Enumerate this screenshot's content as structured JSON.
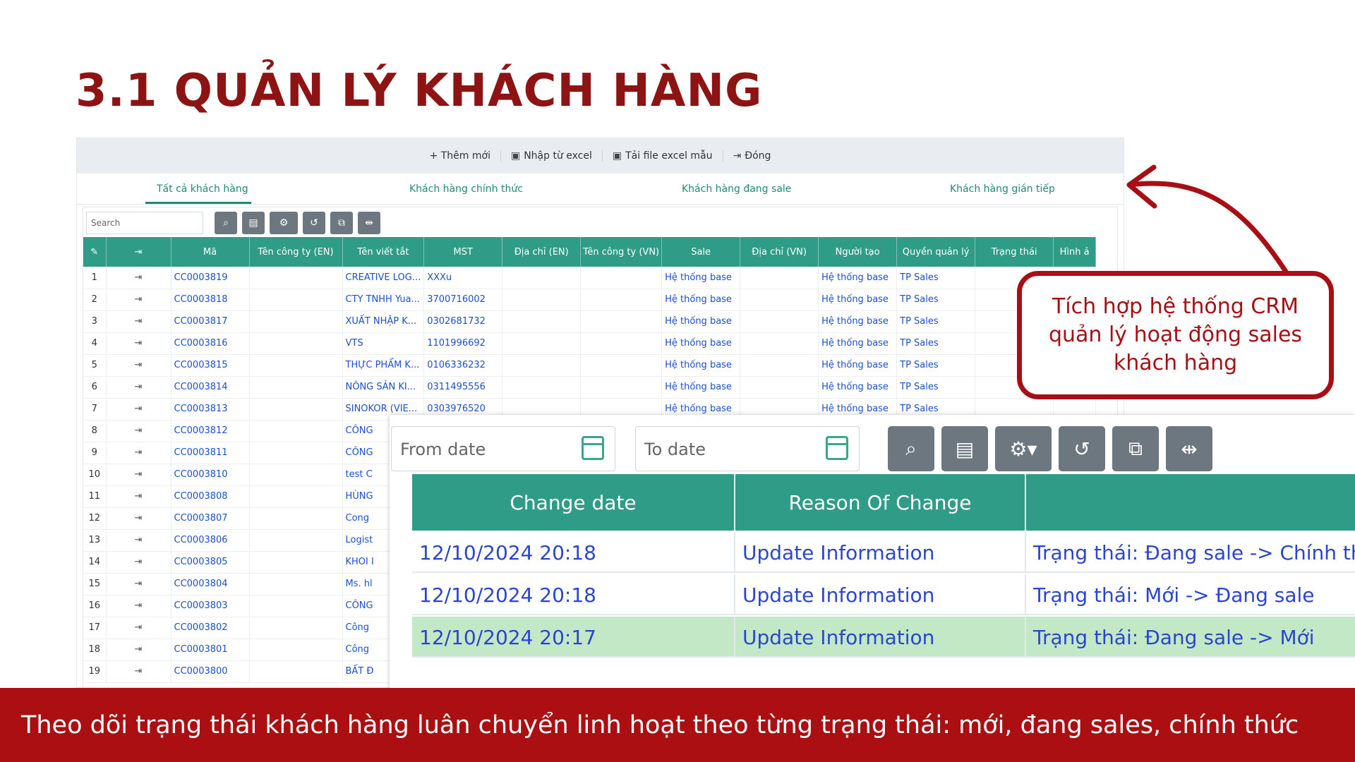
{
  "slide": {
    "title": "3.1 QUẢN LÝ KHÁCH HÀNG",
    "callout": "Tích hợp hệ thống CRM quản lý hoạt động sales khách hàng",
    "footer": "Theo dõi trạng thái khách hàng luân chuyển linh hoạt theo từng trạng thái: mới, đang sales, chính thức"
  },
  "toolbar": {
    "add": "+ Thêm mới",
    "import": "Nhập từ excel",
    "template": "Tải file excel mẫu",
    "close": "Đóng"
  },
  "tabs": [
    "Tất cả khách hàng",
    "Khách hàng chính thức",
    "Khách hàng đang sale",
    "Khách hàng gián tiếp"
  ],
  "search": {
    "placeholder": "Search"
  },
  "grid": {
    "columns": [
      "",
      "",
      "Mã",
      "Tên công ty (EN)",
      "Tên viết tắt",
      "MST",
      "Địa chỉ (EN)",
      "Tên công ty (VN)",
      "Sale",
      "Địa chỉ (VN)",
      "Người tạo",
      "Quyền quản lý",
      "Trạng thái",
      "Hình ả"
    ],
    "rows": [
      {
        "n": "1",
        "code": "CC0003819",
        "short": "CREATIVE LOG...",
        "mst": "XXXu",
        "sale": "Hệ thống base",
        "creator": "Hệ thống base",
        "perm": "TP Sales"
      },
      {
        "n": "2",
        "code": "CC0003818",
        "short": "CTY TNHH Yua...",
        "mst": "3700716002",
        "sale": "Hệ thống base",
        "creator": "Hệ thống base",
        "perm": "TP Sales"
      },
      {
        "n": "3",
        "code": "CC0003817",
        "short": "XUẤT NHẬP K...",
        "mst": "0302681732",
        "sale": "Hệ thống base",
        "creator": "Hệ thống base",
        "perm": "TP Sales"
      },
      {
        "n": "4",
        "code": "CC0003816",
        "short": "VTS",
        "mst": "1101996692",
        "sale": "Hệ thống base",
        "creator": "Hệ thống base",
        "perm": "TP Sales"
      },
      {
        "n": "5",
        "code": "CC0003815",
        "short": "THỰC PHẨM K...",
        "mst": "0106336232",
        "sale": "Hệ thống base",
        "creator": "Hệ thống base",
        "perm": "TP Sales"
      },
      {
        "n": "6",
        "code": "CC0003814",
        "short": "NÔNG SẢN KI...",
        "mst": "0311495556",
        "sale": "Hệ thống base",
        "creator": "Hệ thống base",
        "perm": "TP Sales"
      },
      {
        "n": "7",
        "code": "CC0003813",
        "short": "SINOKOR (VIE...",
        "mst": "0303976520",
        "sale": "Hệ thống base",
        "creator": "Hệ thống base",
        "perm": "TP Sales"
      },
      {
        "n": "8",
        "code": "CC0003812",
        "short": "CÔNG",
        "mst": "",
        "sale": "",
        "creator": "",
        "perm": ""
      },
      {
        "n": "9",
        "code": "CC0003811",
        "short": "CÔNG",
        "mst": "",
        "sale": "",
        "creator": "",
        "perm": ""
      },
      {
        "n": "10",
        "code": "CC0003810",
        "short": "test C",
        "mst": "",
        "sale": "",
        "creator": "",
        "perm": ""
      },
      {
        "n": "11",
        "code": "CC0003808",
        "short": "HÙNG",
        "mst": "",
        "sale": "",
        "creator": "",
        "perm": ""
      },
      {
        "n": "12",
        "code": "CC0003807",
        "short": "Cong",
        "mst": "",
        "sale": "",
        "creator": "",
        "perm": ""
      },
      {
        "n": "13",
        "code": "CC0003806",
        "short": "Logist",
        "mst": "",
        "sale": "",
        "creator": "",
        "perm": ""
      },
      {
        "n": "14",
        "code": "CC0003805",
        "short": "KHOI I",
        "mst": "",
        "sale": "",
        "creator": "",
        "perm": ""
      },
      {
        "n": "15",
        "code": "CC0003804",
        "short": "Ms. hl",
        "mst": "",
        "sale": "",
        "creator": "",
        "perm": ""
      },
      {
        "n": "16",
        "code": "CC0003803",
        "short": "CÔNG",
        "mst": "",
        "sale": "",
        "creator": "",
        "perm": ""
      },
      {
        "n": "17",
        "code": "CC0003802",
        "short": "Công",
        "mst": "",
        "sale": "",
        "creator": "",
        "perm": ""
      },
      {
        "n": "18",
        "code": "CC0003801",
        "short": "Công",
        "mst": "",
        "sale": "",
        "creator": "",
        "perm": ""
      },
      {
        "n": "19",
        "code": "CC0003800",
        "short": "BẤT Đ",
        "mst": "",
        "sale": "",
        "creator": "",
        "perm": ""
      }
    ]
  },
  "history": {
    "from_placeholder": "From date",
    "to_placeholder": "To date",
    "columns": [
      "Change date",
      "Reason Of Change",
      ""
    ],
    "rows": [
      {
        "date": "12/10/2024 20:18",
        "reason": "Update Information",
        "detail": "Trạng thái: Đang sale -> Chính thức"
      },
      {
        "date": "12/10/2024 20:18",
        "reason": "Update Information",
        "detail": "Trạng thái: Mới -> Đang sale"
      },
      {
        "date": "12/10/2024 20:17",
        "reason": "Update Information",
        "detail": "Trạng thái: Đang sale -> Mới"
      }
    ]
  },
  "colors": {
    "brand": "#ab0f12",
    "accent": "#2e9c86",
    "link": "#1c4fd6"
  },
  "icons": [
    "edit-icon",
    "export-icon",
    "search-icon",
    "calendar-icon",
    "settings-icon",
    "undo-icon",
    "crop-icon",
    "compress-icon"
  ]
}
